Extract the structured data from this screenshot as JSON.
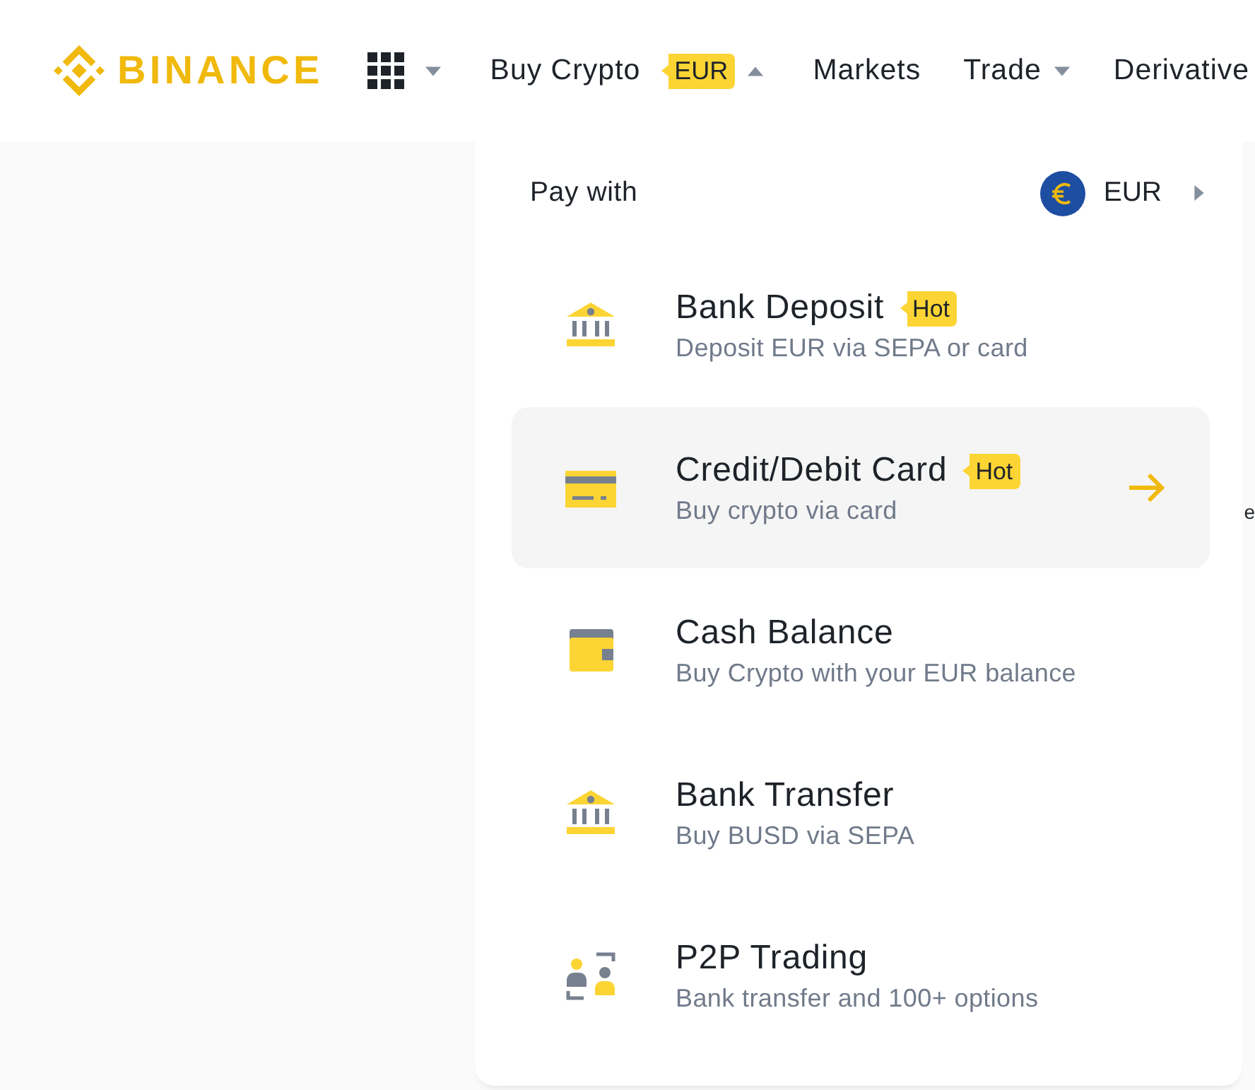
{
  "header": {
    "logo": "BINANCE",
    "nav": [
      {
        "kind": "apps",
        "expanded": false
      },
      {
        "kind": "dropdown",
        "label": "Buy Crypto",
        "badge": "EUR",
        "expanded": true
      },
      {
        "kind": "link",
        "label": "Markets"
      },
      {
        "kind": "dropdown",
        "label": "Trade",
        "expanded": false
      },
      {
        "kind": "link",
        "label": "Derivative"
      }
    ]
  },
  "page": {
    "text_fragment": "e"
  },
  "menu": {
    "title": "Pay with",
    "currency": "EUR",
    "methods": [
      {
        "kind": "bank",
        "title": "Bank Deposit",
        "badge": "Hot",
        "subtitle": "Deposit EUR via SEPA or card",
        "selected": false
      },
      {
        "kind": "card",
        "title": "Credit/Debit Card",
        "badge": "Hot",
        "subtitle": "Buy crypto via card",
        "selected": true
      },
      {
        "kind": "wallet",
        "title": "Cash Balance",
        "subtitle": "Buy Crypto with your EUR balance",
        "selected": false
      },
      {
        "kind": "bank",
        "title": "Bank Transfer",
        "subtitle": "Buy BUSD via SEPA",
        "selected": false
      },
      {
        "kind": "p2p",
        "title": "P2P Trading",
        "subtitle": "Bank transfer and 100+ options",
        "selected": false
      }
    ]
  }
}
